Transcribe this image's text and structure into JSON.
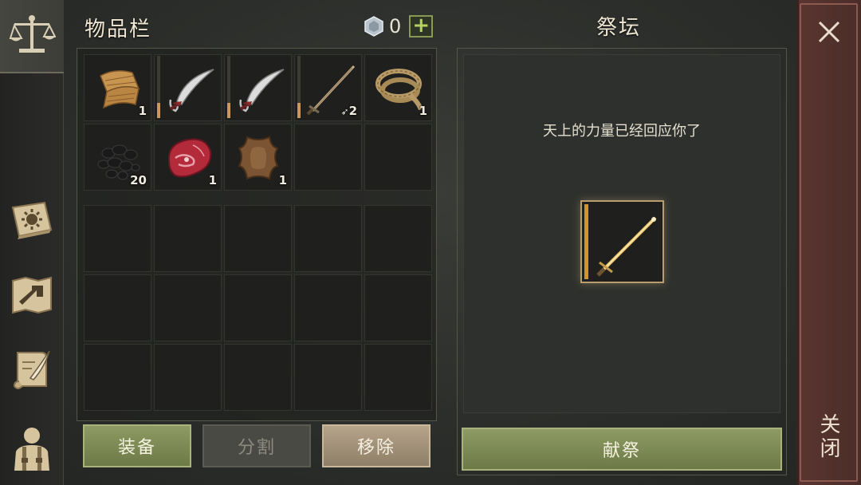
{
  "inventory": {
    "title": "物品栏",
    "currency": {
      "icon": "silver-gem-icon",
      "value": "0",
      "add_icon": "plus-icon"
    },
    "items": [
      {
        "name": "cloth",
        "icon": "cloth-roll-icon",
        "count": "1"
      },
      {
        "name": "scimitar",
        "icon": "scimitar-icon",
        "durability": 0.25
      },
      {
        "name": "scimitar",
        "icon": "scimitar-icon",
        "durability": 0.25
      },
      {
        "name": "sword",
        "icon": "sword-icon",
        "durability": 0.25,
        "count": "2",
        "count_icon": "arrow-icon"
      },
      {
        "name": "rope",
        "icon": "rope-icon",
        "count": "1"
      },
      {
        "name": "coal",
        "icon": "coal-icon",
        "count": "20"
      },
      {
        "name": "raw-meat",
        "icon": "meat-icon",
        "count": "1"
      },
      {
        "name": "leather",
        "icon": "hide-icon",
        "count": "1"
      }
    ],
    "buttons": {
      "equip": "装备",
      "split": "分割",
      "remove": "移除"
    }
  },
  "altar": {
    "title": "祭坛",
    "message": "天上的力量已经回应你了",
    "offering_item": {
      "icon": "golden-sword-icon",
      "durability": 1.0
    },
    "sacrifice_button": "献祭"
  },
  "close": {
    "label": "关闭",
    "icon": "close-x-icon"
  },
  "sidebar": {
    "tabs": [
      {
        "icon": "scales-icon",
        "active": true
      },
      {
        "icon": "sun-book-icon"
      },
      {
        "icon": "map-arrow-icon"
      },
      {
        "icon": "quest-scroll-icon"
      },
      {
        "icon": "character-icon"
      }
    ]
  },
  "colors": {
    "accent_green": "#8d9a62",
    "close_red": "#5a3530",
    "durability": "#c79a5c"
  }
}
